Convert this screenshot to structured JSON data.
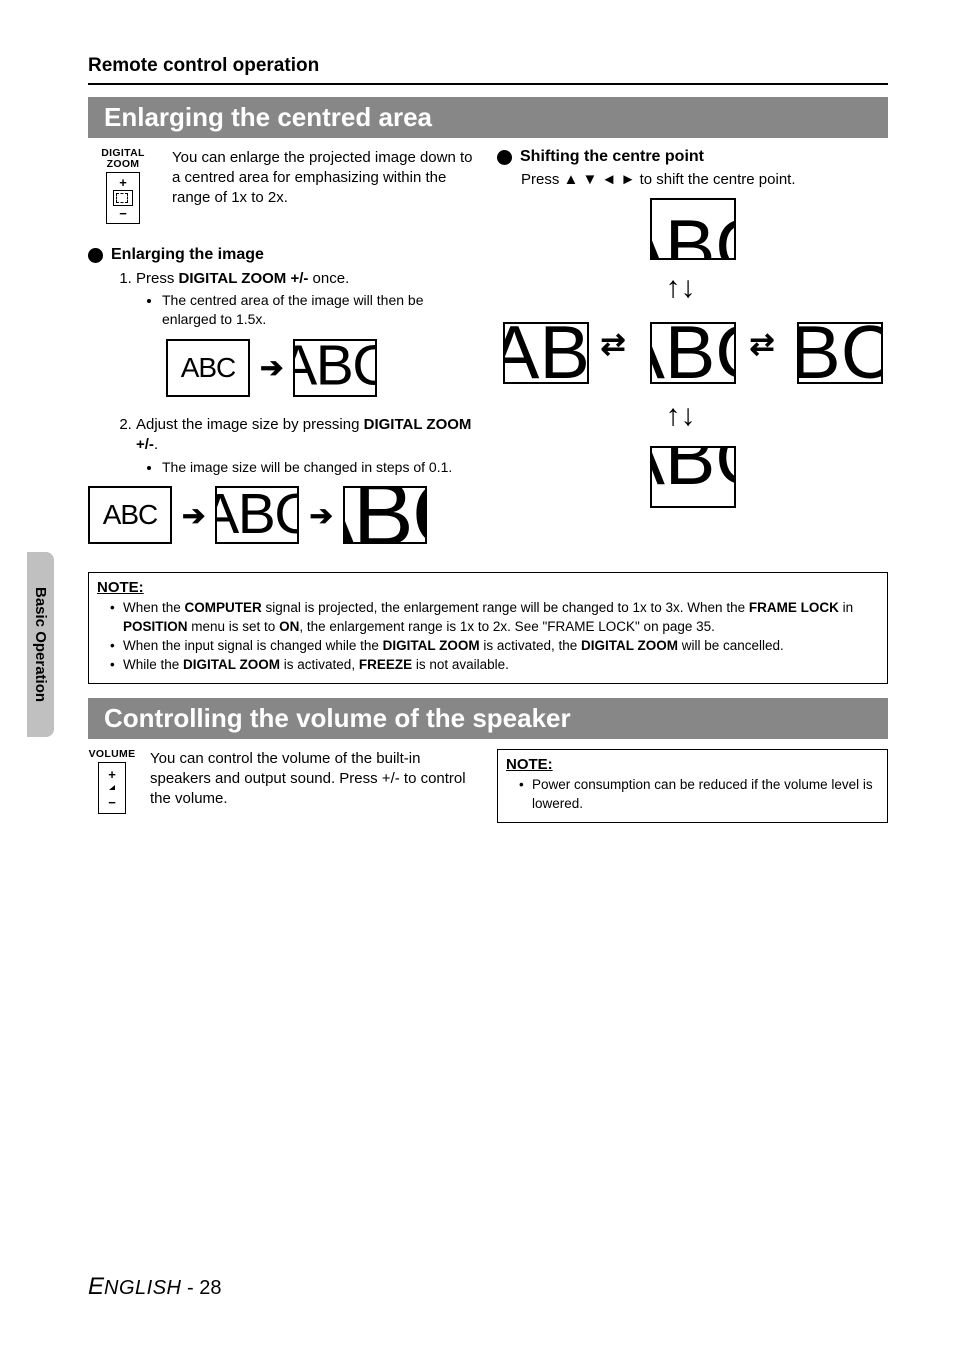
{
  "sidebar": {
    "label": "Basic Operation"
  },
  "page": {
    "title": "Remote control operation",
    "footer_lang": "ENGLISH",
    "footer_page": "28"
  },
  "section1": {
    "heading": "Enlarging the centred area",
    "button_label": "DIGITAL ZOOM",
    "intro": "You can enlarge the projected image down to a centred area for emphasizing within the range of 1x to 2x.",
    "sub1_heading": "Enlarging the image",
    "steps": [
      {
        "prefix": "Press ",
        "bold": "DIGITAL ZOOM +/-",
        "suffix": " once.",
        "bullets": [
          "The centred area of the image will then be enlarged to 1.5x."
        ]
      },
      {
        "prefix": "Adjust the image size by pressing ",
        "bold": "DIGITAL ZOOM +/-",
        "suffix": ".",
        "bullets": [
          "The image size will be changed in steps of 0.1."
        ]
      }
    ],
    "sub2_heading": "Shifting the centre point",
    "shift_desc_prefix": "Press ",
    "shift_desc_suffix": " to shift the centre point.",
    "fig_text_abc": "ABC",
    "note_title": "NOTE:",
    "notes": [
      {
        "parts": [
          "When the ",
          "COMPUTER",
          " signal is projected, the enlargement range will be changed to 1x to 3x. When the ",
          "FRAME LOCK",
          " in ",
          "POSITION",
          " menu is set to ",
          "ON",
          ", the enlargement range is 1x to 2x. See \"FRAME LOCK\" on page 35."
        ]
      },
      {
        "parts": [
          "When the input signal is changed while the ",
          "DIGITAL ZOOM",
          " is activated, the ",
          "DIGITAL ZOOM",
          " will be cancelled."
        ]
      },
      {
        "parts": [
          "While the ",
          "DIGITAL ZOOM",
          " is activated, ",
          "FREEZE",
          " is not available."
        ]
      }
    ]
  },
  "section2": {
    "heading": "Controlling the volume of the speaker",
    "button_label": "VOLUME",
    "intro": "You can control the volume of the built-in speakers and output sound. Press +/- to control the volume.",
    "note_title": "NOTE:",
    "notes": [
      "Power consumption can be reduced if the volume level is lowered."
    ]
  }
}
